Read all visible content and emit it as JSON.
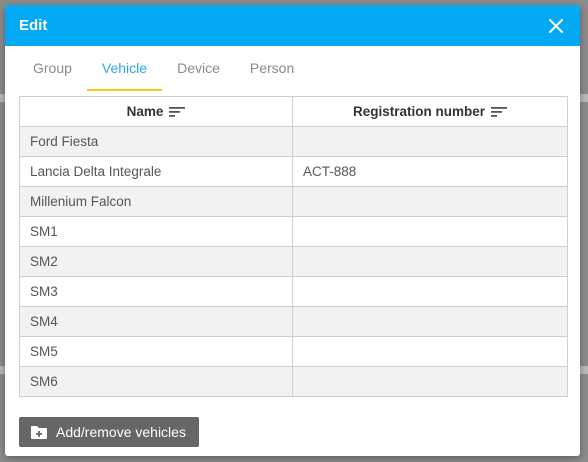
{
  "dialog": {
    "title": "Edit"
  },
  "tabs": [
    {
      "label": "Group",
      "active": false
    },
    {
      "label": "Vehicle",
      "active": true
    },
    {
      "label": "Device",
      "active": false
    },
    {
      "label": "Person",
      "active": false
    }
  ],
  "table": {
    "columns": [
      "Name",
      "Registration number"
    ],
    "rows": [
      {
        "name": "Ford Fiesta",
        "registration": ""
      },
      {
        "name": "Lancia Delta Integrale",
        "registration": "ACT-888"
      },
      {
        "name": "Millenium Falcon",
        "registration": ""
      },
      {
        "name": "SM1",
        "registration": ""
      },
      {
        "name": "SM2",
        "registration": ""
      },
      {
        "name": "SM3",
        "registration": ""
      },
      {
        "name": "SM4",
        "registration": ""
      },
      {
        "name": "SM5",
        "registration": ""
      },
      {
        "name": "SM6",
        "registration": ""
      }
    ]
  },
  "footer": {
    "add_button_label": "Add/remove vehicles"
  },
  "colors": {
    "header": "#03a9f4",
    "active_tab_text": "#29a9e4",
    "active_tab_underline": "#f5c518",
    "button_bg": "#666666"
  },
  "icons": {
    "close": "close-icon",
    "sort": "sort-icon",
    "add_folder": "folder-plus-icon"
  }
}
